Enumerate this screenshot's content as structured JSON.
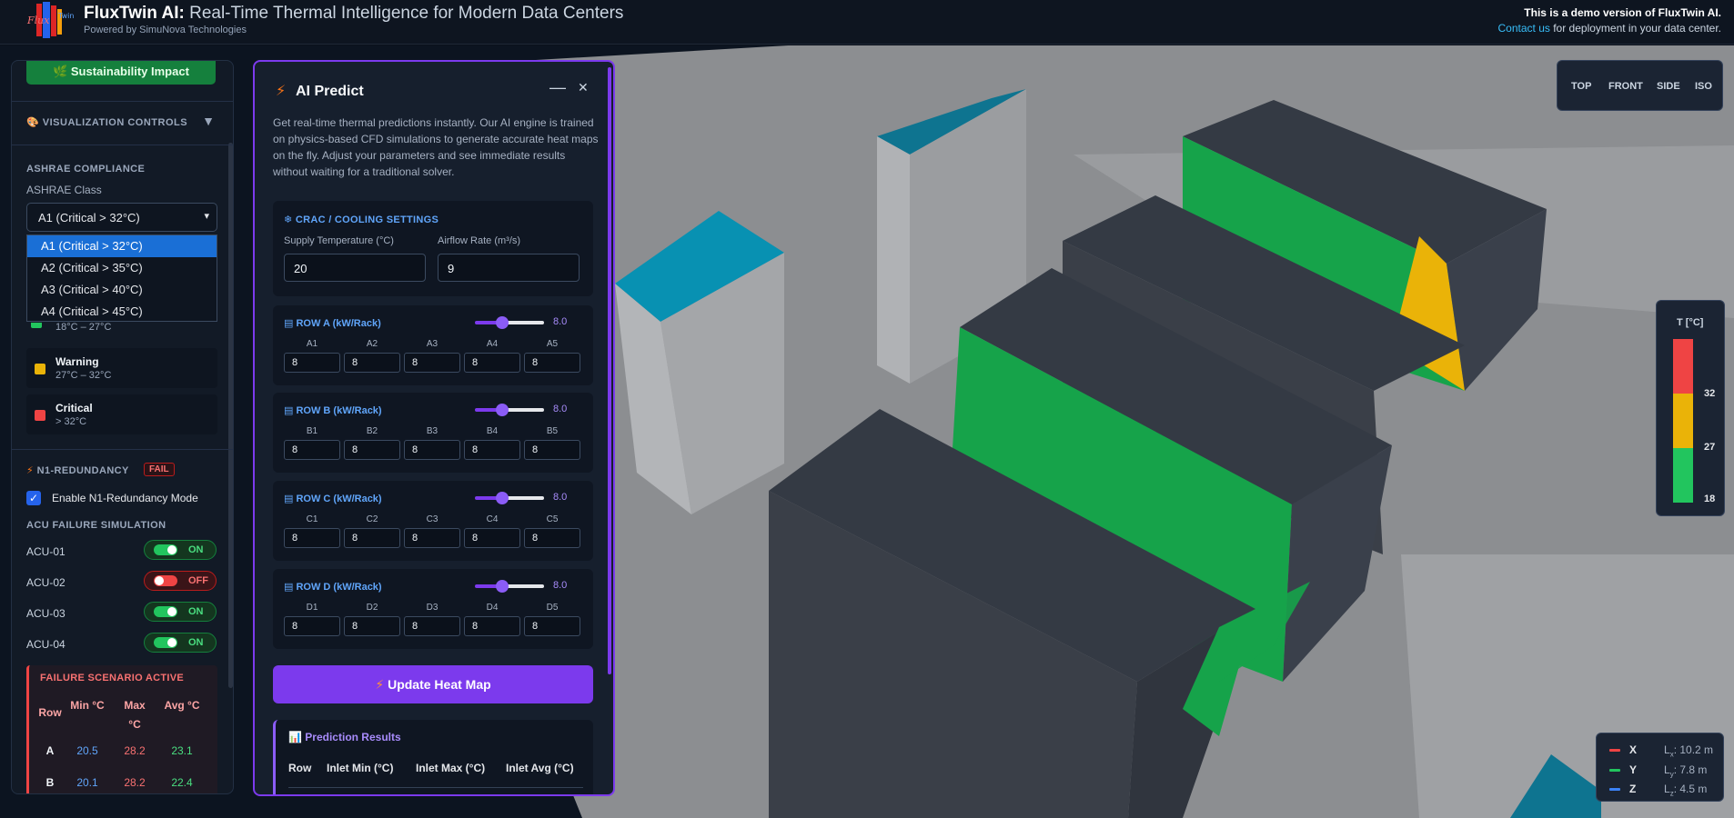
{
  "header": {
    "brand": "FluxTwin AI:",
    "tagline": "Real-Time Thermal Intelligence for Modern Data Centers",
    "powered_by": "Powered by SimuNova Technologies",
    "demo_notice": "This is a demo version of FluxTwin AI.",
    "contact_link": "Contact us",
    "contact_rest": "for deployment in your data center."
  },
  "left_panel": {
    "sustainability_button": "🌿 Sustainability Impact",
    "visualization_controls": "VISUALIZATION CONTROLS",
    "ashrae_compliance": "ASHRAE COMPLIANCE",
    "ashrae_class_label": "ASHRAE Class",
    "ashrae_selected": "A1 (Critical > 32°C)",
    "ashrae_options": [
      "A1 (Critical > 32°C)",
      "A2 (Critical > 35°C)",
      "A3 (Critical > 40°C)",
      "A4 (Critical > 45°C)"
    ],
    "safe_range_partial": "18°C – 27°C",
    "legend": [
      {
        "name": "Warning",
        "range": "27°C – 32°C",
        "color": "#eab308"
      },
      {
        "name": "Critical",
        "range": "> 32°C",
        "color": "#ef4444"
      }
    ],
    "n1_title": "N1-REDUNDANCY",
    "n1_status": "FAIL",
    "n1_checkbox_label": "Enable N1-Redundancy Mode",
    "acu_failure_title": "ACU FAILURE SIMULATION",
    "acus": [
      {
        "name": "ACU-01",
        "state": "ON"
      },
      {
        "name": "ACU-02",
        "state": "OFF"
      },
      {
        "name": "ACU-03",
        "state": "ON"
      },
      {
        "name": "ACU-04",
        "state": "ON"
      }
    ],
    "failure_scenario": {
      "title": "FAILURE SCENARIO ACTIVE",
      "headers": [
        "Row",
        "Min °C",
        "Max °C",
        "Avg °C"
      ],
      "rows": [
        {
          "row": "A",
          "min": "20.5",
          "max": "28.2",
          "avg": "23.1"
        },
        {
          "row": "B",
          "min": "20.1",
          "max": "28.2",
          "avg": "22.4"
        }
      ]
    }
  },
  "ai_predict": {
    "title": "AI Predict",
    "description": "Get real-time thermal predictions instantly. Our AI engine is trained on physics-based CFD simulations to generate accurate heat maps on the fly. Adjust your parameters and see immediate results without waiting for a traditional solver.",
    "crac_title": "CRAC / COOLING SETTINGS",
    "supply_temp_label": "Supply Temperature (°C)",
    "supply_temp_value": "20",
    "airflow_label": "Airflow Rate (m³/s)",
    "airflow_value": "9",
    "rows": [
      {
        "title": "ROW A (kW/Rack)",
        "slider": "8.0",
        "slider_fraction": 0.4,
        "racks": [
          {
            "id": "A1",
            "v": "8"
          },
          {
            "id": "A2",
            "v": "8"
          },
          {
            "id": "A3",
            "v": "8"
          },
          {
            "id": "A4",
            "v": "8"
          },
          {
            "id": "A5",
            "v": "8"
          }
        ]
      },
      {
        "title": "ROW B (kW/Rack)",
        "slider": "8.0",
        "slider_fraction": 0.4,
        "racks": [
          {
            "id": "B1",
            "v": "8"
          },
          {
            "id": "B2",
            "v": "8"
          },
          {
            "id": "B3",
            "v": "8"
          },
          {
            "id": "B4",
            "v": "8"
          },
          {
            "id": "B5",
            "v": "8"
          }
        ]
      },
      {
        "title": "ROW C (kW/Rack)",
        "slider": "8.0",
        "slider_fraction": 0.4,
        "racks": [
          {
            "id": "C1",
            "v": "8"
          },
          {
            "id": "C2",
            "v": "8"
          },
          {
            "id": "C3",
            "v": "8"
          },
          {
            "id": "C4",
            "v": "8"
          },
          {
            "id": "C5",
            "v": "8"
          }
        ]
      },
      {
        "title": "ROW D (kW/Rack)",
        "slider": "8.0",
        "slider_fraction": 0.4,
        "racks": [
          {
            "id": "D1",
            "v": "8"
          },
          {
            "id": "D2",
            "v": "8"
          },
          {
            "id": "D3",
            "v": "8"
          },
          {
            "id": "D4",
            "v": "8"
          },
          {
            "id": "D5",
            "v": "8"
          }
        ]
      }
    ],
    "update_button": "Update Heat Map",
    "results_title": "Prediction Results",
    "results_headers": [
      "Row",
      "Inlet Min (°C)",
      "Inlet Max (°C)",
      "Inlet Avg (°C)"
    ]
  },
  "view_buttons": [
    "TOP",
    "FRONT",
    "SIDE",
    "ISO"
  ],
  "temp_legend": {
    "title": "T [°C]",
    "ticks": [
      "32",
      "27",
      "18"
    ],
    "colors": {
      "critical": "#ef4444",
      "warning": "#eab308",
      "safe": "#22c55e"
    }
  },
  "axes": [
    {
      "axis": "X",
      "dim": "L",
      "sub": "x",
      "value": ": 10.2 m",
      "color": "#ef4444"
    },
    {
      "axis": "Y",
      "dim": "L",
      "sub": "y",
      "value": ": 7.8 m",
      "color": "#22c55e"
    },
    {
      "axis": "Z",
      "dim": "L",
      "sub": "z",
      "value": ": 4.5 m",
      "color": "#3b82f6"
    }
  ]
}
